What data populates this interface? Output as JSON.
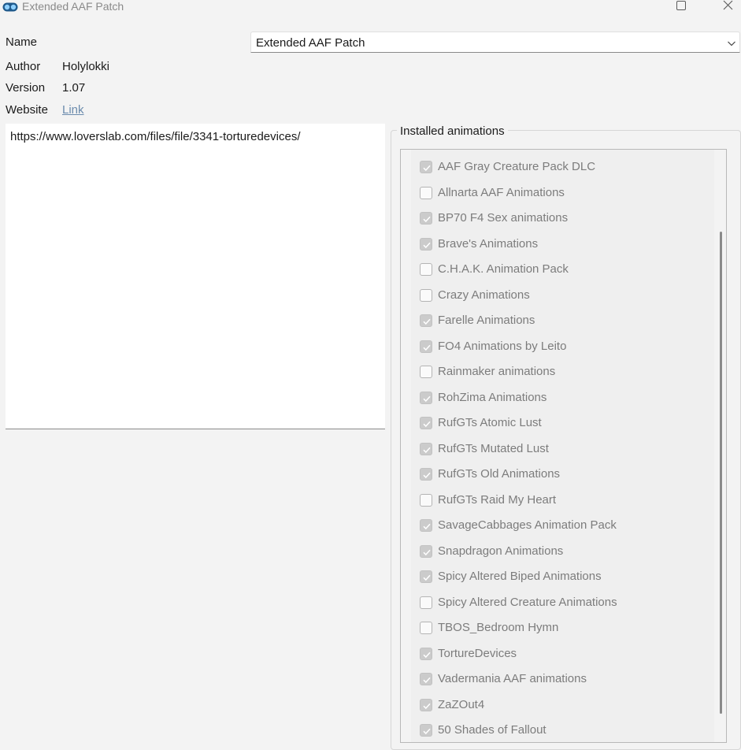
{
  "window": {
    "title": "Extended AAF Patch"
  },
  "fields": {
    "name_label": "Name",
    "author_label": "Author",
    "author_value": "Holylokki",
    "version_label": "Version",
    "version_value": "1.07",
    "website_label": "Website",
    "website_link": "Link"
  },
  "name_select": {
    "value": "Extended AAF Patch"
  },
  "description": {
    "text": "https://www.loverslab.com/files/file/3341-torturedevices/"
  },
  "animations": {
    "title": "Installed animations",
    "items": [
      {
        "label": "AAF Gray Creature Pack DLC",
        "checked": true
      },
      {
        "label": "Allnarta AAF Animations",
        "checked": false
      },
      {
        "label": "BP70 F4 Sex animations",
        "checked": true
      },
      {
        "label": "Brave's Animations",
        "checked": true
      },
      {
        "label": "C.H.A.K. Animation Pack",
        "checked": false
      },
      {
        "label": "Crazy Animations",
        "checked": false
      },
      {
        "label": "Farelle Animations",
        "checked": true
      },
      {
        "label": "FO4 Animations by Leito",
        "checked": true
      },
      {
        "label": "Rainmaker animations",
        "checked": false
      },
      {
        "label": "RohZima Animations",
        "checked": true
      },
      {
        "label": "RufGTs Atomic Lust",
        "checked": true
      },
      {
        "label": "RufGTs Mutated Lust",
        "checked": true
      },
      {
        "label": "RufGTs Old Animations",
        "checked": true
      },
      {
        "label": "RufGTs Raid My Heart",
        "checked": false
      },
      {
        "label": "SavageCabbages Animation Pack",
        "checked": true
      },
      {
        "label": "Snapdragon Animations",
        "checked": true
      },
      {
        "label": "Spicy Altered Biped Animations",
        "checked": true
      },
      {
        "label": "Spicy Altered Creature Animations",
        "checked": false
      },
      {
        "label": "TBOS_Bedroom Hymn",
        "checked": false
      },
      {
        "label": "TortureDevices",
        "checked": true
      },
      {
        "label": "Vadermania AAF animations",
        "checked": true
      },
      {
        "label": "ZaZOut4",
        "checked": true
      },
      {
        "label": "50 Shades of Fallout",
        "checked": true
      }
    ]
  }
}
